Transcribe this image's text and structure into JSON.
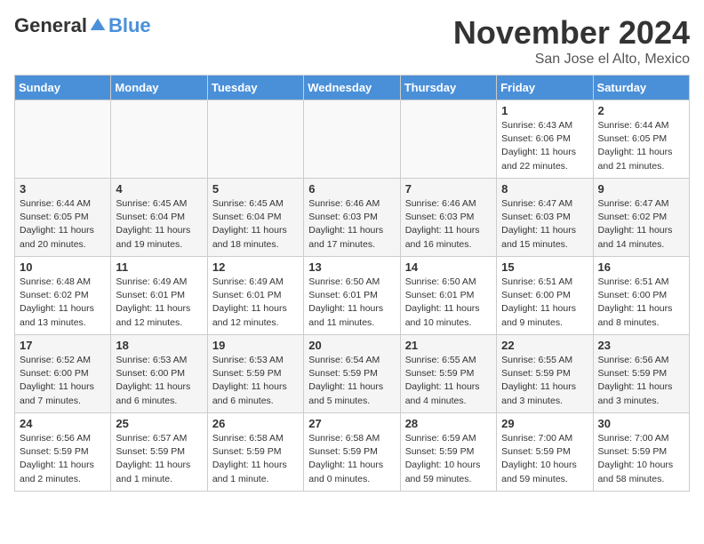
{
  "logo": {
    "general": "General",
    "blue": "Blue"
  },
  "header": {
    "month": "November 2024",
    "location": "San Jose el Alto, Mexico"
  },
  "weekdays": [
    "Sunday",
    "Monday",
    "Tuesday",
    "Wednesday",
    "Thursday",
    "Friday",
    "Saturday"
  ],
  "weeks": [
    [
      {
        "day": "",
        "info": ""
      },
      {
        "day": "",
        "info": ""
      },
      {
        "day": "",
        "info": ""
      },
      {
        "day": "",
        "info": ""
      },
      {
        "day": "",
        "info": ""
      },
      {
        "day": "1",
        "info": "Sunrise: 6:43 AM\nSunset: 6:06 PM\nDaylight: 11 hours and 22 minutes."
      },
      {
        "day": "2",
        "info": "Sunrise: 6:44 AM\nSunset: 6:05 PM\nDaylight: 11 hours and 21 minutes."
      }
    ],
    [
      {
        "day": "3",
        "info": "Sunrise: 6:44 AM\nSunset: 6:05 PM\nDaylight: 11 hours and 20 minutes."
      },
      {
        "day": "4",
        "info": "Sunrise: 6:45 AM\nSunset: 6:04 PM\nDaylight: 11 hours and 19 minutes."
      },
      {
        "day": "5",
        "info": "Sunrise: 6:45 AM\nSunset: 6:04 PM\nDaylight: 11 hours and 18 minutes."
      },
      {
        "day": "6",
        "info": "Sunrise: 6:46 AM\nSunset: 6:03 PM\nDaylight: 11 hours and 17 minutes."
      },
      {
        "day": "7",
        "info": "Sunrise: 6:46 AM\nSunset: 6:03 PM\nDaylight: 11 hours and 16 minutes."
      },
      {
        "day": "8",
        "info": "Sunrise: 6:47 AM\nSunset: 6:03 PM\nDaylight: 11 hours and 15 minutes."
      },
      {
        "day": "9",
        "info": "Sunrise: 6:47 AM\nSunset: 6:02 PM\nDaylight: 11 hours and 14 minutes."
      }
    ],
    [
      {
        "day": "10",
        "info": "Sunrise: 6:48 AM\nSunset: 6:02 PM\nDaylight: 11 hours and 13 minutes."
      },
      {
        "day": "11",
        "info": "Sunrise: 6:49 AM\nSunset: 6:01 PM\nDaylight: 11 hours and 12 minutes."
      },
      {
        "day": "12",
        "info": "Sunrise: 6:49 AM\nSunset: 6:01 PM\nDaylight: 11 hours and 12 minutes."
      },
      {
        "day": "13",
        "info": "Sunrise: 6:50 AM\nSunset: 6:01 PM\nDaylight: 11 hours and 11 minutes."
      },
      {
        "day": "14",
        "info": "Sunrise: 6:50 AM\nSunset: 6:01 PM\nDaylight: 11 hours and 10 minutes."
      },
      {
        "day": "15",
        "info": "Sunrise: 6:51 AM\nSunset: 6:00 PM\nDaylight: 11 hours and 9 minutes."
      },
      {
        "day": "16",
        "info": "Sunrise: 6:51 AM\nSunset: 6:00 PM\nDaylight: 11 hours and 8 minutes."
      }
    ],
    [
      {
        "day": "17",
        "info": "Sunrise: 6:52 AM\nSunset: 6:00 PM\nDaylight: 11 hours and 7 minutes."
      },
      {
        "day": "18",
        "info": "Sunrise: 6:53 AM\nSunset: 6:00 PM\nDaylight: 11 hours and 6 minutes."
      },
      {
        "day": "19",
        "info": "Sunrise: 6:53 AM\nSunset: 5:59 PM\nDaylight: 11 hours and 6 minutes."
      },
      {
        "day": "20",
        "info": "Sunrise: 6:54 AM\nSunset: 5:59 PM\nDaylight: 11 hours and 5 minutes."
      },
      {
        "day": "21",
        "info": "Sunrise: 6:55 AM\nSunset: 5:59 PM\nDaylight: 11 hours and 4 minutes."
      },
      {
        "day": "22",
        "info": "Sunrise: 6:55 AM\nSunset: 5:59 PM\nDaylight: 11 hours and 3 minutes."
      },
      {
        "day": "23",
        "info": "Sunrise: 6:56 AM\nSunset: 5:59 PM\nDaylight: 11 hours and 3 minutes."
      }
    ],
    [
      {
        "day": "24",
        "info": "Sunrise: 6:56 AM\nSunset: 5:59 PM\nDaylight: 11 hours and 2 minutes."
      },
      {
        "day": "25",
        "info": "Sunrise: 6:57 AM\nSunset: 5:59 PM\nDaylight: 11 hours and 1 minute."
      },
      {
        "day": "26",
        "info": "Sunrise: 6:58 AM\nSunset: 5:59 PM\nDaylight: 11 hours and 1 minute."
      },
      {
        "day": "27",
        "info": "Sunrise: 6:58 AM\nSunset: 5:59 PM\nDaylight: 11 hours and 0 minutes."
      },
      {
        "day": "28",
        "info": "Sunrise: 6:59 AM\nSunset: 5:59 PM\nDaylight: 10 hours and 59 minutes."
      },
      {
        "day": "29",
        "info": "Sunrise: 7:00 AM\nSunset: 5:59 PM\nDaylight: 10 hours and 59 minutes."
      },
      {
        "day": "30",
        "info": "Sunrise: 7:00 AM\nSunset: 5:59 PM\nDaylight: 10 hours and 58 minutes."
      }
    ]
  ]
}
